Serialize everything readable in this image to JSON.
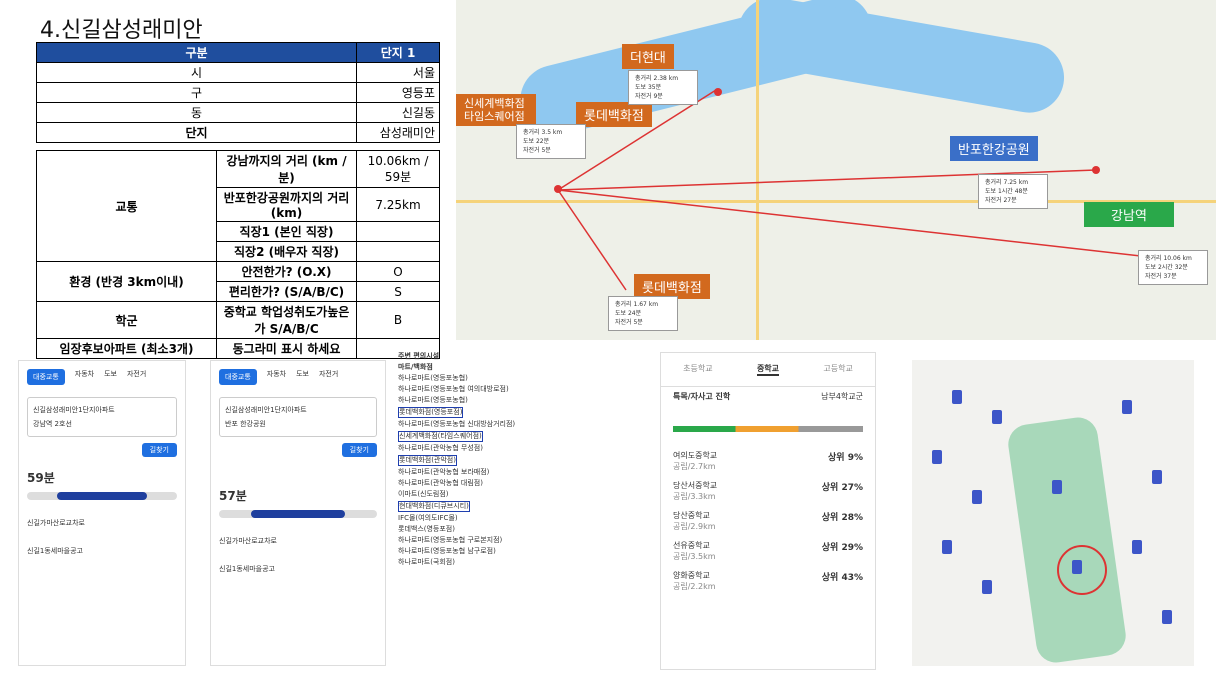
{
  "title": "4.신길삼성래미안",
  "table1": {
    "header": [
      "구분",
      "단지 1"
    ],
    "rows": [
      [
        "시",
        "서울"
      ],
      [
        "구",
        "영등포"
      ],
      [
        "동",
        "신길동"
      ],
      [
        "단지",
        "삼성래미안"
      ]
    ]
  },
  "table2": {
    "traffic_label": "교통",
    "gangnam_q": "강남까지의 거리 (km / 분)",
    "gangnam_a": "10.06km / 59분",
    "banpo_q": "반포한강공원까지의 거리 (km)",
    "banpo_a": "7.25km",
    "job1": "직장1 (본인 직장)",
    "job2": "직장2 (배우자 직장)",
    "env_label": "환경 (반경 3km이내)",
    "safe_q": "안전한가? (O.X)",
    "safe_a": "O",
    "conv_q": "편리한가? (S/A/B/C)",
    "conv_a": "S",
    "school_label": "학군",
    "school_q": "중학교 학업성취도가높은가 S/A/B/C",
    "school_a": "B",
    "apt_label": "임장후보아파트 (최소3개)",
    "apt_note": "동그라미 표시 하세요"
  },
  "map1": {
    "labels": {
      "hyundai": "더현대",
      "shinsegae": "신세계백화점 타임스퀘어점",
      "lotte1": "롯데백화점",
      "banpo": "반포한강공원",
      "gangnam": "강남역",
      "lotte2": "롯데백화점"
    },
    "colors": {
      "orange": "#d2691e",
      "blue": "#3a6fc8",
      "green": "#2aa84a"
    }
  },
  "route1": {
    "tabs": [
      "대중교통",
      "자동차",
      "도보",
      "자전거"
    ],
    "from": "신길삼성래미안1단지아파트",
    "to": "강남역 2호선",
    "go": "길찾기",
    "total_time": "59분",
    "line1": "신길가마산로교차로",
    "line2": "신길1동세마을공고"
  },
  "route2": {
    "tabs": [
      "대중교통",
      "자동차",
      "도보",
      "자전거"
    ],
    "from": "신길삼성래미안1단지아파트",
    "to": "반포 한강공원",
    "go": "길찾기",
    "total_time": "57분",
    "line1": "신길가마산로교차로",
    "line2": "신길1동세마을공고"
  },
  "shops": {
    "header": "주변 편의시설",
    "category": "마트/백화점",
    "items": [
      "하나로마트(영등포농협)",
      "하나로마트(영등포농협 여의대방로점)",
      "하나로마트(영등포농협)",
      "롯데백화점(영등포점)",
      "하나로마트(영등포농협 신대방삼거리점)",
      "신세계백화점(타임스퀘어점)",
      "하나로마트(관악농협 무성점)",
      "롯데백화점(관악점)",
      "하나로마트(관악농협 보라매점)",
      "하나로마트(관악농협 대림점)",
      "이마트(신도림점)",
      "현대백화점(디큐브시티)",
      "IFC몰(여의도IFC몰)",
      "롯데백스(영등포점)",
      "하나로마트(영등포농협 구로본지점)",
      "하나로마트(영등포농협 남구로점)",
      "하나로마트(국회점)"
    ]
  },
  "schools": {
    "tabs": [
      "초등학교",
      "중학교",
      "고등학교"
    ],
    "section": "특목/자사고 진학",
    "district": "남부4학교군",
    "list": [
      {
        "name": "여의도중학교",
        "rank": "상위 9%",
        "dist": "공립/2.7km"
      },
      {
        "name": "당산서중학교",
        "rank": "상위 27%",
        "dist": "공립/3.3km"
      },
      {
        "name": "당산중학교",
        "rank": "상위 28%",
        "dist": "공립/2.9km"
      },
      {
        "name": "선유중학교",
        "rank": "상위 29%",
        "dist": "공립/3.5km"
      },
      {
        "name": "양화중학교",
        "rank": "상위 43%",
        "dist": "공립/2.2km"
      }
    ]
  }
}
